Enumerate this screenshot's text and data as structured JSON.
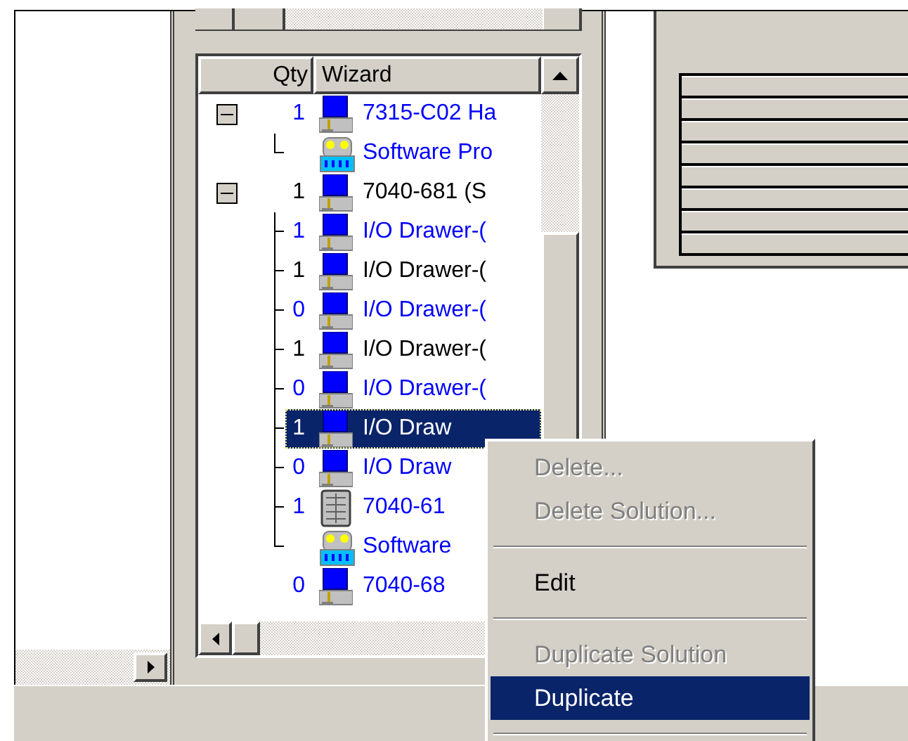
{
  "list": {
    "columns": [
      {
        "label": "Qty"
      },
      {
        "label": "Wizard"
      }
    ],
    "rows": [
      {
        "qty": "1",
        "label": "7315-C02 Ha",
        "kind": "computer",
        "color": "#0000ff",
        "selected": false,
        "expanded": true,
        "children": [
          {
            "label": "Software Pro",
            "kind": "software",
            "color": "#0000ff",
            "selected": false
          }
        ]
      },
      {
        "qty": "1",
        "label": "7040-681 (S",
        "kind": "computer",
        "color": "#000000",
        "selected": false,
        "expanded": true,
        "children": [
          {
            "qty": "1",
            "label": "I/O Drawer-(",
            "kind": "computer",
            "color": "#0000ff",
            "selected": false
          },
          {
            "qty": "1",
            "label": "I/O Drawer-(",
            "kind": "computer",
            "color": "#000000",
            "selected": false
          },
          {
            "qty": "0",
            "label": "I/O Drawer-(",
            "kind": "computer",
            "color": "#0000ff",
            "selected": false
          },
          {
            "qty": "1",
            "label": "I/O Drawer-(",
            "kind": "computer",
            "color": "#000000",
            "selected": false
          },
          {
            "qty": "0",
            "label": "I/O Drawer-(",
            "kind": "computer",
            "color": "#0000ff",
            "selected": false
          },
          {
            "qty": "1",
            "label": "I/O Draw",
            "kind": "computer",
            "selected": true
          },
          {
            "qty": "0",
            "label": "I/O Draw",
            "kind": "computer",
            "color": "#0000ff",
            "selected": false
          },
          {
            "qty": "1",
            "label": "7040-61",
            "kind": "rack",
            "color": "#0000ff",
            "selected": false
          },
          {
            "label": "Software",
            "kind": "software",
            "color": "#0000ff",
            "selected": false
          }
        ]
      },
      {
        "qty": "0",
        "label": "7040-68",
        "kind": "computer",
        "color": "#0000ff",
        "selected": false
      }
    ]
  },
  "context_menu": [
    {
      "kind": "item",
      "label": "Delete...",
      "disabled": true,
      "selected": false
    },
    {
      "kind": "item",
      "label": "Delete Solution...",
      "disabled": true,
      "selected": false
    },
    {
      "kind": "separator"
    },
    {
      "kind": "item",
      "label": "Edit",
      "disabled": false,
      "selected": false
    },
    {
      "kind": "separator"
    },
    {
      "kind": "item",
      "label": "Duplicate Solution",
      "disabled": true,
      "selected": false
    },
    {
      "kind": "item",
      "label": "Duplicate",
      "disabled": false,
      "selected": true
    },
    {
      "kind": "separator"
    }
  ]
}
